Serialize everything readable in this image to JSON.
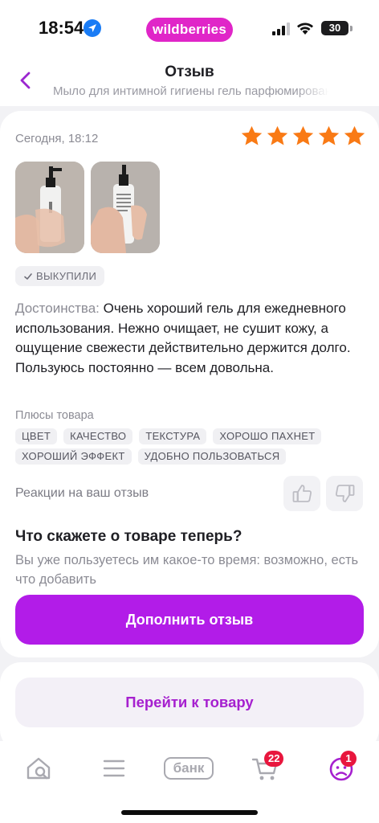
{
  "status_bar": {
    "time": "18:54",
    "brand": "wildberries",
    "battery": "30",
    "icons": [
      "location-arrow-icon",
      "signal-icon",
      "wifi-icon",
      "battery-icon"
    ]
  },
  "header": {
    "title": "Отзыв",
    "subtitle": "Мыло для интимной гигиены гель парфюмированное",
    "back_icon": "chevron-left-icon"
  },
  "review": {
    "date": "Сегодня, 18:12",
    "rating": 5,
    "rating_max": 5,
    "star_color": "#f97a15",
    "photos_count": 2,
    "bought_badge": "ВЫКУПИЛИ",
    "advantages_label": "Достоинства:",
    "advantages_text": "Очень хороший гель для ежедневного использования. Нежно очищает, не сушит кожу, а ощущение свежести действительно держится долго. Пользуюсь постоянно — всем довольна.",
    "pros_title": "Плюсы товара",
    "pros_tags": [
      "ЦВЕТ",
      "КАЧЕСТВО",
      "ТЕКСТУРА",
      "ХОРОШО ПАХНЕТ",
      "ХОРОШИЙ ЭФФЕКТ",
      "УДОБНО ПОЛЬЗОВАТЬСЯ"
    ],
    "reactions_label": "Реакции на ваш отзыв"
  },
  "followup": {
    "title": "Что скажете о товаре теперь?",
    "subtitle": "Вы уже пользуетесь им какое-то время: возможно, есть что добавить",
    "button": "Дополнить отзыв"
  },
  "goto_button": "Перейти к товару",
  "tabbar": {
    "bank_label": "банк",
    "cart_badge": "22",
    "profile_badge": "1",
    "icons": [
      "home-search-icon",
      "menu-icon",
      "bank-icon",
      "cart-icon",
      "profile-icon"
    ]
  },
  "colors": {
    "accent": "#b21ce8",
    "brand": "#e025c8",
    "badge_red": "#e8163d"
  }
}
